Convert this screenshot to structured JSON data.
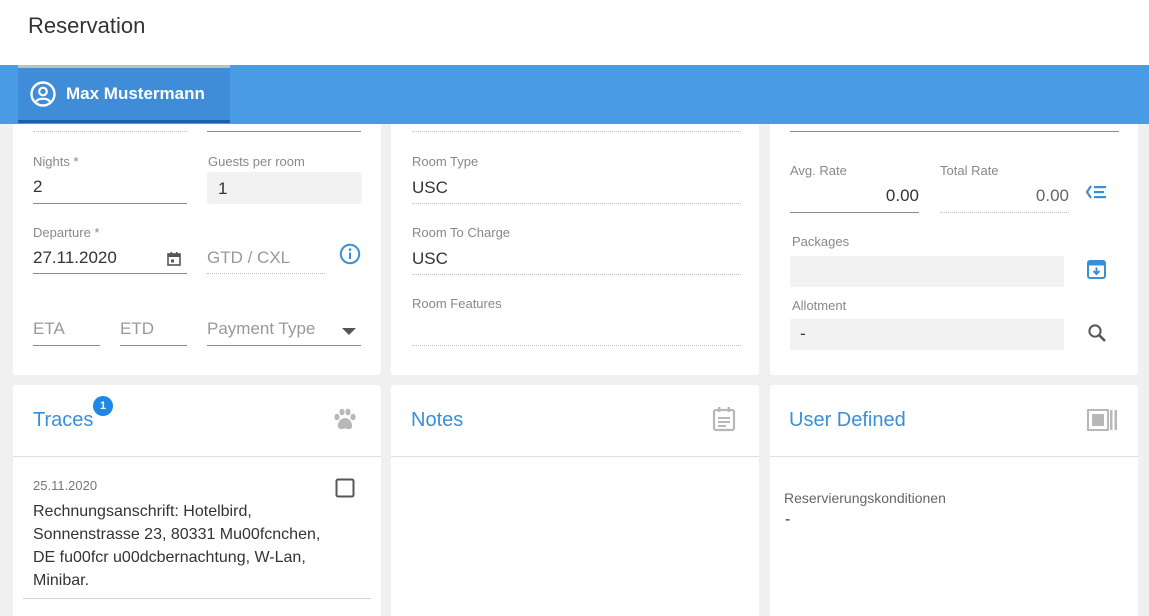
{
  "header": {
    "title": "Reservation"
  },
  "tab": {
    "label": "Max Mustermann"
  },
  "stay": {
    "nights_label": "Nights *",
    "nights_value": "2",
    "guests_label": "Guests per room",
    "guests_value": "1",
    "departure_label": "Departure *",
    "departure_value": "27.11.2020",
    "gtd_placeholder": "GTD / CXL",
    "eta_placeholder": "ETA",
    "etd_placeholder": "ETD",
    "payment_placeholder": "Payment Type"
  },
  "room": {
    "room_type_label": "Room Type",
    "room_type_value": "USC",
    "room_to_charge_label": "Room To Charge",
    "room_to_charge_value": "USC",
    "room_features_label": "Room Features"
  },
  "rates": {
    "avg_rate_label": "Avg. Rate",
    "avg_rate_value": "0.00",
    "total_rate_label": "Total Rate",
    "total_rate_value": "0.00",
    "packages_label": "Packages",
    "allotment_label": "Allotment",
    "allotment_value": "-"
  },
  "traces": {
    "title": "Traces",
    "badge": "1",
    "date": "25.11.2020",
    "text_lines": [
      "Rechnungsanschrift: Hotelbird,",
      "Sonnenstrasse 23, 80331 Mu00fcnchen,",
      "DE fu00fcr u00dcbernachtung, W-Lan,",
      "Minibar."
    ]
  },
  "notes": {
    "title": "Notes"
  },
  "user_defined": {
    "title": "User Defined",
    "field_label": "Reservierungskonditionen",
    "field_value": "-"
  },
  "colors": {
    "accent": "#4a9be6",
    "title_blue": "#3b8fd8",
    "badge": "#1e88e5"
  },
  "icons": [
    "account-circle-icon",
    "calendar-icon",
    "info-icon",
    "dropdown-arrow-icon",
    "rate-list-icon",
    "package-archive-icon",
    "search-icon",
    "paw-icon",
    "notes-calendar-icon",
    "id-card-icon",
    "checkbox-icon"
  ]
}
